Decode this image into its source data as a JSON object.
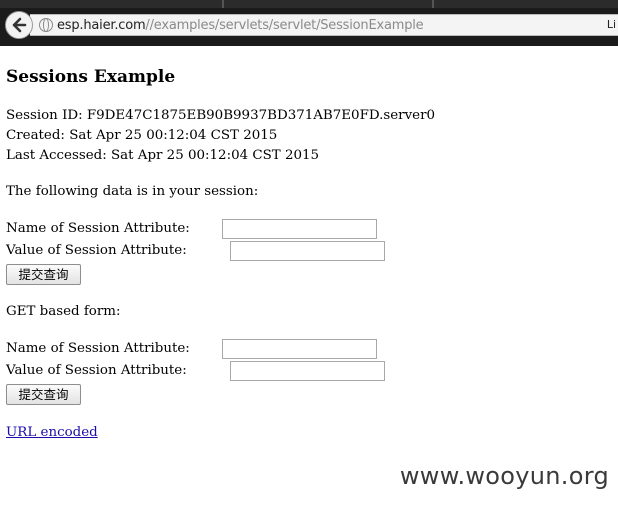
{
  "browser": {
    "url_host": "esp.haier.com",
    "url_path": "//examples/servlets/servlet/SessionExample",
    "right_text": "Li"
  },
  "page": {
    "title": "Sessions Example",
    "session_id": "Session ID: F9DE47C1875EB90B9937BD371AB7E0FD.server0",
    "created": "Created: Sat Apr 25 00:12:04 CST 2015",
    "last_accessed": "Last Accessed: Sat Apr 25 00:12:04 CST 2015",
    "data_intro": "The following data is in your session:",
    "form1": {
      "name_label": "Name of Session Attribute:",
      "value_label": "Value of Session Attribute:",
      "name_value": "",
      "value_value": "",
      "submit_label": "提交查询"
    },
    "get_form_label": "GET based form:",
    "form2": {
      "name_label": "Name of Session Attribute:",
      "value_label": "Value of Session Attribute:",
      "name_value": "",
      "value_value": "",
      "submit_label": "提交查询"
    },
    "url_encoded_link": "URL encoded"
  },
  "watermark": "www.wooyun.org",
  "colors": {
    "link": "#1a0dab",
    "chrome_bg": "#1b1b1b"
  }
}
